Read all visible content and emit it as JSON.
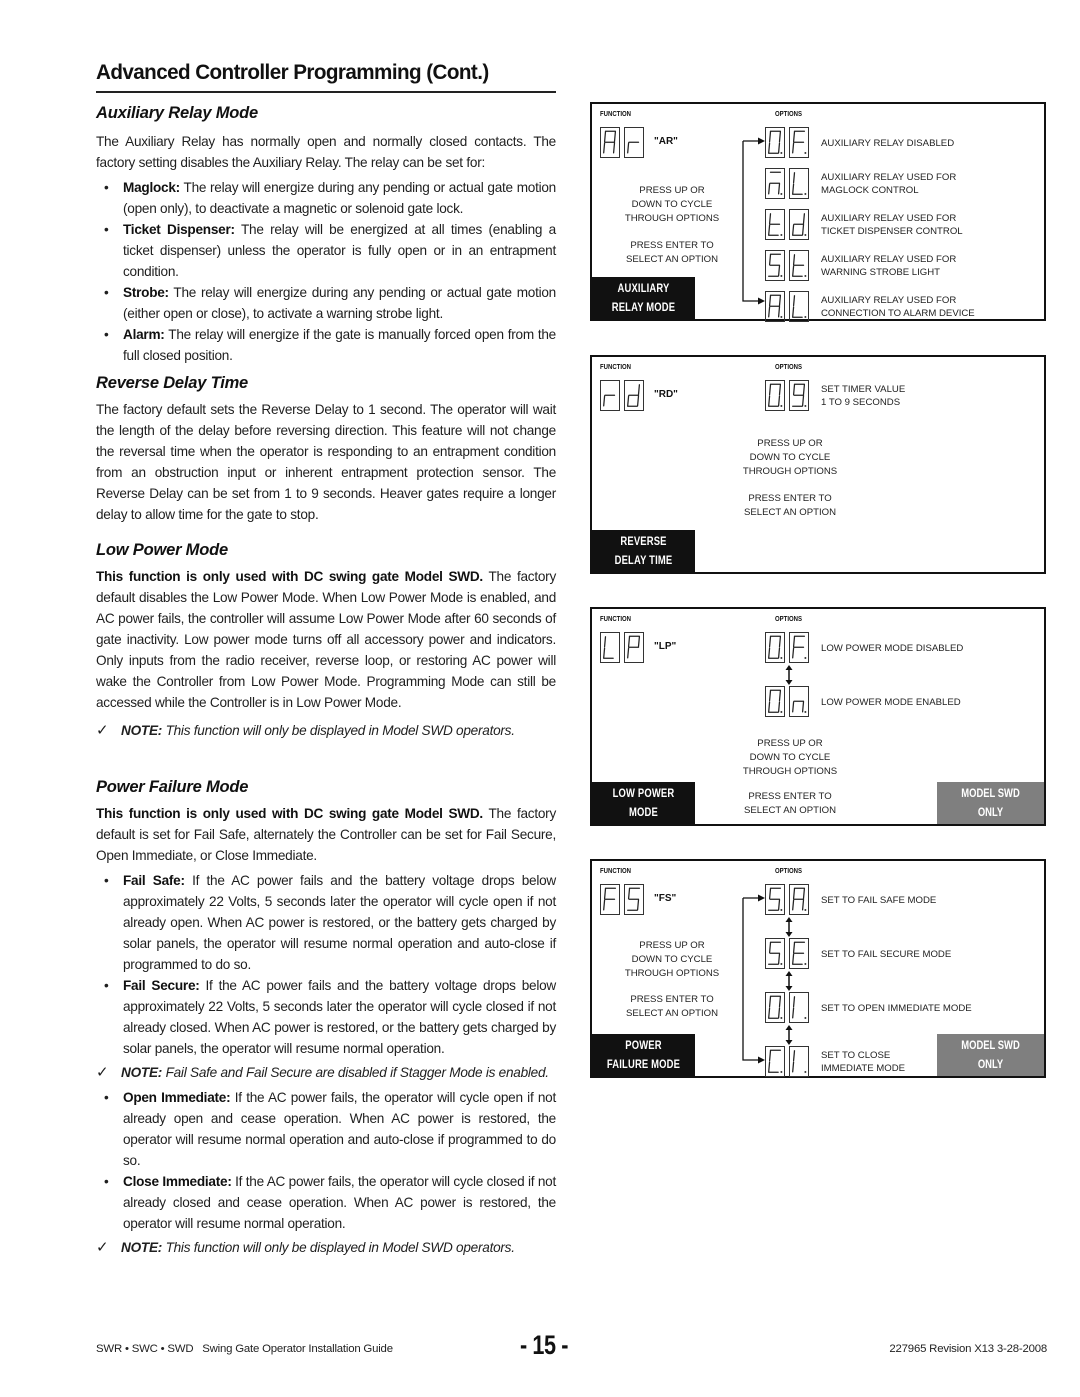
{
  "page": {
    "title": "Advanced Controller Programming (Cont.)"
  },
  "auxiliary_relay": {
    "heading": "Auxiliary Relay Mode",
    "intro": "The Auxiliary Relay has normally open and normally closed contacts. The factory setting disables the Auxiliary Relay. The relay can be set for:",
    "bullets": [
      {
        "term": "Maglock:",
        "text": " The relay will energize during any pending or actual gate motion (open only), to deactivate a magnetic or solenoid gate lock."
      },
      {
        "term": "Ticket Dispenser:",
        "text": " The relay will be energized at all times (enabling a ticket dispenser) unless the operator is fully open or in an entrapment condition."
      },
      {
        "term": "Strobe:",
        "text": " The relay will energize during any pending or actual gate motion (either open or close), to activate a warning strobe light."
      },
      {
        "term": "Alarm:",
        "text": " The relay will energize if the gate is manually forced open from the full closed position."
      }
    ]
  },
  "reverse_delay": {
    "heading": "Reverse Delay Time",
    "text": "The factory default sets the Reverse Delay to 1 second. The operator will wait the length of the delay before reversing direction. This feature will not change the reversal time when the operator is responding to an entrapment condition from an obstruction input or inherent entrapment protection sensor. The Reverse Delay can be set from 1 to 9 seconds. Heaver gates require a longer delay to allow time for the gate to stop."
  },
  "low_power": {
    "heading": "Low Power Mode",
    "bold_lead": "This function is only used with DC swing gate Model SWD.",
    "text": " The factory default disables the Low Power Mode. When Low Power Mode is enabled, and AC power fails, the controller will assume Low Power Mode after 60 seconds of gate inactivity. Low power mode turns off all accessory power and indicators. Only inputs from the radio receiver, reverse loop, or restoring AC power will wake the Controller from Low Power Mode. Programming Mode can still be accessed while the Controller is in Low Power Mode.",
    "note_label": "NOTE:",
    "note_text": " This function will only be displayed in Model SWD operators."
  },
  "power_failure": {
    "heading": "Power Failure Mode",
    "bold_lead": "This function is only used with DC swing gate Model SWD.",
    "text": " The factory default is set for Fail Safe, alternately the Controller can be set for Fail Secure, Open Immediate, or Close Immediate.",
    "bullets_a": [
      {
        "term": "Fail Safe:",
        "text": " If the AC power fails and the battery voltage drops below approximately 22 Volts, 5 seconds later the operator will cycle open if not already open. When AC power is restored, or the battery gets charged by solar panels, the operator will resume normal operation and auto-close if programmed to do so."
      },
      {
        "term": "Fail Secure:",
        "text": " If the AC power fails and the battery voltage drops below approximately 22 Volts, 5 seconds later the operator will cycle closed if not already closed. When AC power is restored, or the battery gets charged by solar panels, the operator will resume normal operation."
      }
    ],
    "note1_label": "NOTE:",
    "note1_text": " Fail Safe and Fail Secure are disabled if Stagger Mode is enabled.",
    "bullets_b": [
      {
        "term": "Open Immediate:",
        "text": " If the AC power fails, the operator will cycle open if not already open and cease operation. When AC power is restored, the operator will resume normal operation and auto-close if programmed to do so."
      },
      {
        "term": "Close Immediate:",
        "text": " If the AC power fails, the operator will cycle closed if not already closed and cease operation. When AC power is restored, the operator will resume normal operation."
      }
    ],
    "note2_label": "NOTE:",
    "note2_text": " This function will only be displayed in Model SWD operators."
  },
  "panels": {
    "function_label": "FUNCTION",
    "options_label": "OPTIONS",
    "press_up": [
      "PRESS UP OR",
      "DOWN TO CYCLE",
      "THROUGH OPTIONS"
    ],
    "press_enter": [
      "PRESS ENTER TO",
      "SELECT AN OPTION"
    ],
    "model_tag": [
      "MODEL SWD",
      "ONLY"
    ],
    "ar": {
      "code": "\"AR\"",
      "digits": [
        "A",
        "r"
      ],
      "tag": [
        "AUXILIARY",
        "RELAY MODE"
      ],
      "options": [
        {
          "digits": [
            "0.",
            "F."
          ],
          "lines": [
            "AUXILIARY RELAY DISABLED"
          ]
        },
        {
          "digits": [
            "m.",
            "L."
          ],
          "lines": [
            "AUXILIARY RELAY USED FOR",
            "MAGLOCK CONTROL"
          ]
        },
        {
          "digits": [
            "t.",
            "d."
          ],
          "lines": [
            "AUXILIARY RELAY USED FOR",
            "TICKET DISPENSER CONTROL"
          ]
        },
        {
          "digits": [
            "S.",
            "t."
          ],
          "lines": [
            "AUXILIARY RELAY USED FOR",
            "WARNING STROBE LIGHT"
          ]
        },
        {
          "digits": [
            "A.",
            "L."
          ],
          "lines": [
            "AUXILIARY RELAY USED FOR",
            "CONNECTION TO ALARM DEVICE"
          ]
        }
      ]
    },
    "rd": {
      "code": "\"RD\"",
      "digits": [
        "r",
        "d"
      ],
      "tag": [
        "REVERSE",
        "DELAY TIME"
      ],
      "options": [
        {
          "digits": [
            "0.",
            "9."
          ],
          "lines": [
            "SET TIMER VALUE",
            "1 TO 9 SECONDS"
          ]
        }
      ]
    },
    "lp": {
      "code": "\"LP\"",
      "digits": [
        "L",
        "P"
      ],
      "tag": [
        "LOW POWER",
        "MODE"
      ],
      "options": [
        {
          "digits": [
            "0.",
            "F."
          ],
          "lines": [
            "LOW POWER MODE DISABLED"
          ]
        },
        {
          "digits": [
            "0.",
            "n."
          ],
          "lines": [
            "LOW POWER MODE ENABLED"
          ]
        }
      ]
    },
    "fs": {
      "code": "\"FS\"",
      "digits": [
        "F",
        "S"
      ],
      "tag": [
        "POWER",
        "FAILURE MODE"
      ],
      "options": [
        {
          "digits": [
            "S.",
            "A."
          ],
          "lines": [
            "SET TO FAIL SAFE MODE"
          ]
        },
        {
          "digits": [
            "S.",
            "E."
          ],
          "lines": [
            "SET TO FAIL SECURE MODE"
          ]
        },
        {
          "digits": [
            "0.",
            "I."
          ],
          "lines": [
            "SET TO OPEN IMMEDIATE MODE"
          ]
        },
        {
          "digits": [
            "C.",
            "I."
          ],
          "lines": [
            "SET TO CLOSE",
            "IMMEDIATE MODE"
          ]
        }
      ]
    }
  },
  "footer": {
    "left": "SWR • SWC • SWD   Swing Gate Operator Installation Guide",
    "page": "- 15 -",
    "right": "227965 Revision X13 3-28-2008"
  }
}
